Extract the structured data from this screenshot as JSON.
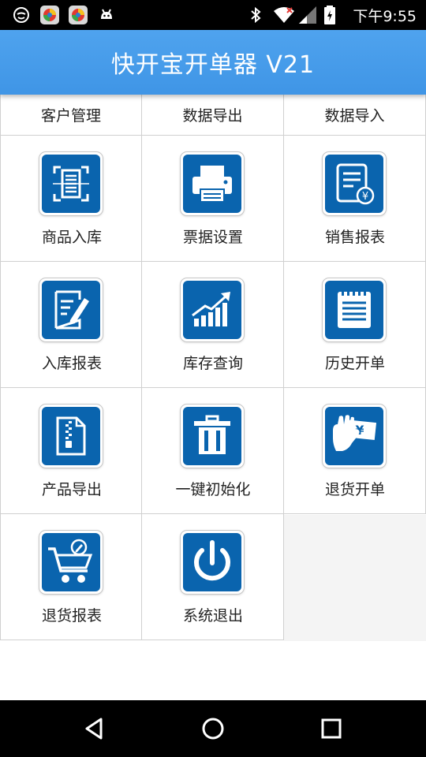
{
  "status_bar": {
    "time": "下午9:55",
    "left_icons": [
      "smiley-icon",
      "browser-icon",
      "browser-icon",
      "android-icon"
    ],
    "right_icons": [
      "bluetooth-icon",
      "wifi-icon",
      "signal-icon",
      "battery-icon"
    ]
  },
  "header": {
    "title": "快开宝开单器 V21"
  },
  "top_menu": [
    {
      "label": "客户管理"
    },
    {
      "label": "数据导出"
    },
    {
      "label": "数据导入"
    }
  ],
  "tiles": [
    {
      "label": "商品入库",
      "icon": "scan-document-icon"
    },
    {
      "label": "票据设置",
      "icon": "printer-icon"
    },
    {
      "label": "销售报表",
      "icon": "sales-report-icon"
    },
    {
      "label": "入库报表",
      "icon": "edit-document-icon"
    },
    {
      "label": "库存查询",
      "icon": "growth-chart-icon"
    },
    {
      "label": "历史开单",
      "icon": "notepad-icon"
    },
    {
      "label": "产品导出",
      "icon": "zip-file-icon"
    },
    {
      "label": "一键初始化",
      "icon": "trash-icon"
    },
    {
      "label": "退货开单",
      "icon": "money-hand-icon"
    },
    {
      "label": "退货报表",
      "icon": "shopping-cart-icon"
    },
    {
      "label": "系统退出",
      "icon": "power-icon"
    }
  ],
  "colors": {
    "title_bar": "#4a9fec",
    "icon_blue": "#0a64ae",
    "status_bar": "#000000"
  }
}
